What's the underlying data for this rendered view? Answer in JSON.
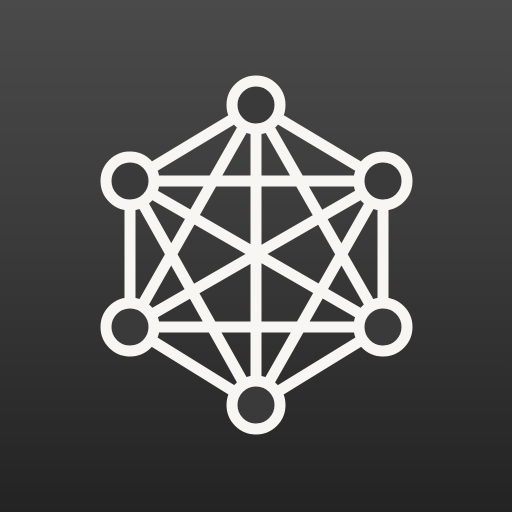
{
  "icon": {
    "name": "network-graph-icon",
    "glyph_color": "#f7f6f2",
    "background_top": "#4a4a4a",
    "background_bottom": "#232323",
    "node_fill": "#3a3a3a",
    "node_count": 6,
    "shape": "hexagon with fully connected nodes"
  }
}
